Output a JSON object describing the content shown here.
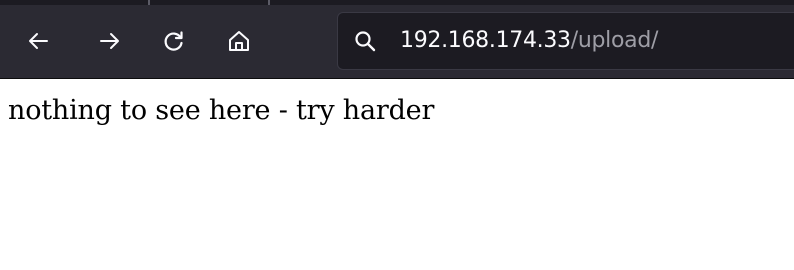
{
  "toolbar": {
    "back_icon": "back-arrow-icon",
    "forward_icon": "forward-arrow-icon",
    "reload_icon": "reload-icon",
    "home_icon": "home-icon"
  },
  "urlbar": {
    "icon": "search-icon",
    "host": "192.168.174.33",
    "path": "/upload/"
  },
  "page": {
    "body_text": "nothing to see here - try harder"
  },
  "colors": {
    "toolbar_bg": "#2b2a33",
    "urlbar_bg": "#1c1b22",
    "icon_color": "#fbfbfe",
    "url_path_color": "#9e9ea6",
    "page_bg": "#ffffff"
  }
}
